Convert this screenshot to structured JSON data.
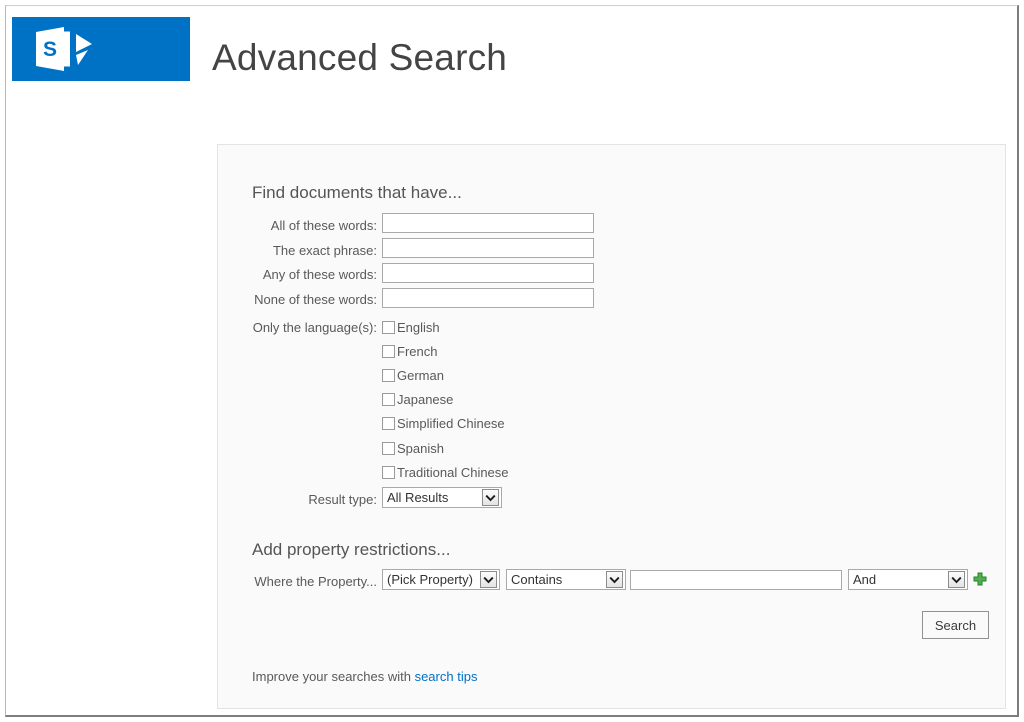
{
  "header": {
    "title": "Advanced Search",
    "logo_icon": "sharepoint-logo-icon",
    "logo_letter": "S",
    "brand_color": "#0072c6"
  },
  "panel": {
    "find_heading": "Find documents that have...",
    "fields": [
      {
        "label": "All of these words:",
        "value": "",
        "placeholder": ""
      },
      {
        "label": "The exact phrase:",
        "value": "",
        "placeholder": ""
      },
      {
        "label": "Any of these words:",
        "value": "",
        "placeholder": ""
      },
      {
        "label": "None of these words:",
        "value": "",
        "placeholder": ""
      }
    ],
    "language_label": "Only the language(s):",
    "languages": [
      {
        "label": "English",
        "checked": false
      },
      {
        "label": "French",
        "checked": false
      },
      {
        "label": "German",
        "checked": false
      },
      {
        "label": "Japanese",
        "checked": false
      },
      {
        "label": "Simplified Chinese",
        "checked": false
      },
      {
        "label": "Spanish",
        "checked": false
      },
      {
        "label": "Traditional Chinese",
        "checked": false
      }
    ],
    "result_type_label": "Result type:",
    "result_type_value": "All Results",
    "property_heading": "Add property restrictions...",
    "property_row_label": "Where the Property...",
    "property_name_value": "(Pick Property)",
    "property_operator_value": "Contains",
    "property_value": "",
    "property_conjunction_value": "And",
    "add_icon": "plus-icon",
    "add_icon_color": "#3fa83f",
    "search_button_label": "Search",
    "tips_prefix": "Improve your searches with ",
    "tips_link_text": "search tips",
    "tips_link_color": "#0072c6"
  }
}
